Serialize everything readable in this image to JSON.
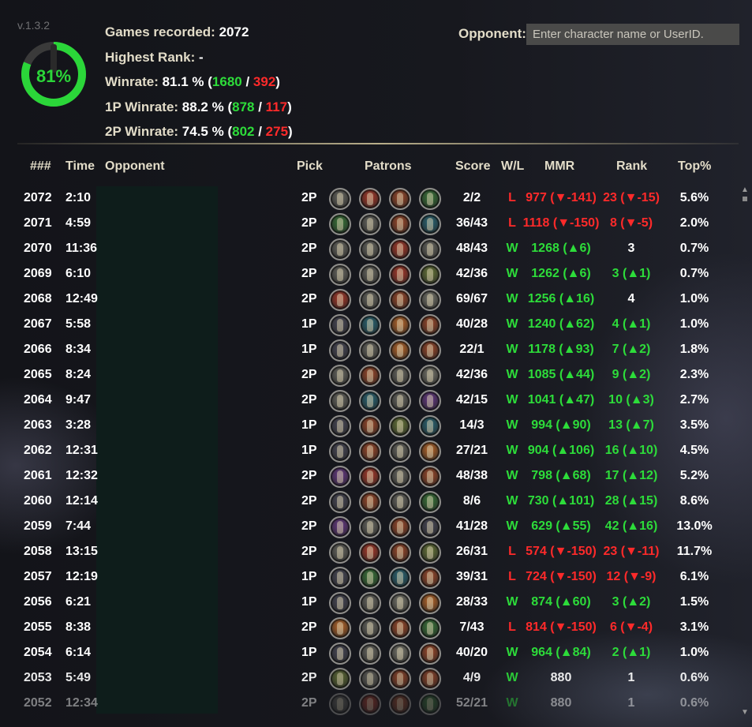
{
  "app": {
    "version": "v.1.3.2",
    "winrate_gauge": {
      "label": "81%",
      "fraction": 0.811,
      "color": "#2bd639"
    }
  },
  "stats": {
    "games_label": "Games recorded:",
    "games_value": "2072",
    "highest_rank_label": "Highest Rank:",
    "highest_rank_value": "-",
    "winrate_label": "Winrate:",
    "winrate_value": "81.1 %",
    "winrate_wins": "1680",
    "winrate_losses": "392",
    "p1_label": "1P Winrate:",
    "p1_value": "88.2 %",
    "p1_wins": "878",
    "p1_losses": "117",
    "p2_label": "2P Winrate:",
    "p2_value": "74.5 %",
    "p2_wins": "802",
    "p2_losses": "275"
  },
  "opponent_search": {
    "label": "Opponent:",
    "placeholder": "Enter character name or UserID.",
    "value": ""
  },
  "colors": {
    "win": "#2ddc3a",
    "loss": "#ff2a2a",
    "accent": "#b8ae8a"
  },
  "table": {
    "headers": {
      "num": "###",
      "time": "Time",
      "opponent": "Opponent",
      "pick": "Pick",
      "patrons": "Patrons",
      "score": "Score",
      "wl": "W/L",
      "mmr": "MMR",
      "rank": "Rank",
      "top": "Top%"
    },
    "rows": [
      {
        "num": "2072",
        "time": "2:10",
        "pick": "2P",
        "patrons": [
          "#6b6b65",
          "#b03a2a",
          "#a24a2a",
          "#3a7a3a"
        ],
        "score": "2/2",
        "wl": "L",
        "mmr": "977",
        "mmr_delta": "▼-141",
        "mmr_dir": "down",
        "rank": "23",
        "rank_delta": "▼-15",
        "rank_dir": "down",
        "top": "5.6%",
        "fade": ""
      },
      {
        "num": "2071",
        "time": "4:59",
        "pick": "2P",
        "patrons": [
          "#3a7a3a",
          "#6b6b65",
          "#a24a2a",
          "#2a6a7a"
        ],
        "score": "36/43",
        "wl": "L",
        "mmr": "1118",
        "mmr_delta": "▼-150",
        "mmr_dir": "down",
        "rank": "8",
        "rank_delta": "▼-5",
        "rank_dir": "down",
        "top": "2.0%",
        "fade": ""
      },
      {
        "num": "2070",
        "time": "11:36",
        "pick": "2P",
        "patrons": [
          "#6b6b65",
          "#6b6b65",
          "#b03a2a",
          "#6b6b65"
        ],
        "score": "48/43",
        "wl": "W",
        "mmr": "1268",
        "mmr_delta": "▲6",
        "mmr_dir": "up",
        "rank": "3",
        "rank_delta": "",
        "rank_dir": "none",
        "top": "0.7%",
        "fade": ""
      },
      {
        "num": "2069",
        "time": "6:10",
        "pick": "2P",
        "patrons": [
          "#6b6b65",
          "#6b6b65",
          "#b03a2a",
          "#6a7a3a"
        ],
        "score": "42/36",
        "wl": "W",
        "mmr": "1262",
        "mmr_delta": "▲6",
        "mmr_dir": "up",
        "rank": "3",
        "rank_delta": "▲1",
        "rank_dir": "up",
        "top": "0.7%",
        "fade": ""
      },
      {
        "num": "2068",
        "time": "12:49",
        "pick": "2P",
        "patrons": [
          "#b03a2a",
          "#6b6b65",
          "#a24a2a",
          "#7a7a70"
        ],
        "score": "69/67",
        "wl": "W",
        "mmr": "1256",
        "mmr_delta": "▲16",
        "mmr_dir": "up",
        "rank": "4",
        "rank_delta": "",
        "rank_dir": "none",
        "top": "1.0%",
        "fade": ""
      },
      {
        "num": "2067",
        "time": "5:58",
        "pick": "1P",
        "patrons": [
          "#4a4a5a",
          "#2a6a7a",
          "#c06a2a",
          "#a24a2a"
        ],
        "score": "40/28",
        "wl": "W",
        "mmr": "1240",
        "mmr_delta": "▲62",
        "mmr_dir": "up",
        "rank": "4",
        "rank_delta": "▲1",
        "rank_dir": "up",
        "top": "1.0%",
        "fade": ""
      },
      {
        "num": "2066",
        "time": "8:34",
        "pick": "1P",
        "patrons": [
          "#4a4a5a",
          "#6b6b65",
          "#c06a2a",
          "#a24a2a"
        ],
        "score": "22/1",
        "wl": "W",
        "mmr": "1178",
        "mmr_delta": "▲93",
        "mmr_dir": "up",
        "rank": "7",
        "rank_delta": "▲2",
        "rank_dir": "up",
        "top": "1.8%",
        "fade": ""
      },
      {
        "num": "2065",
        "time": "8:24",
        "pick": "2P",
        "patrons": [
          "#6b6b65",
          "#a24a2a",
          "#6b6b65",
          "#7a7a70"
        ],
        "score": "42/36",
        "wl": "W",
        "mmr": "1085",
        "mmr_delta": "▲44",
        "mmr_dir": "up",
        "rank": "9",
        "rank_delta": "▲2",
        "rank_dir": "up",
        "top": "2.3%",
        "fade": ""
      },
      {
        "num": "2064",
        "time": "9:47",
        "pick": "2P",
        "patrons": [
          "#6b6b65",
          "#2a6a7a",
          "#6b6b65",
          "#6a3a8a"
        ],
        "score": "42/15",
        "wl": "W",
        "mmr": "1041",
        "mmr_delta": "▲47",
        "mmr_dir": "up",
        "rank": "10",
        "rank_delta": "▲3",
        "rank_dir": "up",
        "top": "2.7%",
        "fade": ""
      },
      {
        "num": "2063",
        "time": "3:28",
        "pick": "1P",
        "patrons": [
          "#4a4a5a",
          "#a24a2a",
          "#6a7a3a",
          "#2a6a7a"
        ],
        "score": "14/3",
        "wl": "W",
        "mmr": "994",
        "mmr_delta": "▲90",
        "mmr_dir": "up",
        "rank": "13",
        "rank_delta": "▲7",
        "rank_dir": "up",
        "top": "3.5%",
        "fade": ""
      },
      {
        "num": "2062",
        "time": "12:31",
        "pick": "1P",
        "patrons": [
          "#4a4a5a",
          "#a24a2a",
          "#6b6b65",
          "#c06a2a"
        ],
        "score": "27/21",
        "wl": "W",
        "mmr": "904",
        "mmr_delta": "▲106",
        "mmr_dir": "up",
        "rank": "16",
        "rank_delta": "▲10",
        "rank_dir": "up",
        "top": "4.5%",
        "fade": ""
      },
      {
        "num": "2061",
        "time": "12:32",
        "pick": "2P",
        "patrons": [
          "#6a3a8a",
          "#b03a2a",
          "#6b6b65",
          "#a24a2a"
        ],
        "score": "48/38",
        "wl": "W",
        "mmr": "798",
        "mmr_delta": "▲68",
        "mmr_dir": "up",
        "rank": "17",
        "rank_delta": "▲12",
        "rank_dir": "up",
        "top": "5.2%",
        "fade": ""
      },
      {
        "num": "2060",
        "time": "12:14",
        "pick": "2P",
        "patrons": [
          "#4a4a5a",
          "#a24a2a",
          "#6b6b65",
          "#3a7a3a"
        ],
        "score": "8/6",
        "wl": "W",
        "mmr": "730",
        "mmr_delta": "▲101",
        "mmr_dir": "up",
        "rank": "28",
        "rank_delta": "▲15",
        "rank_dir": "up",
        "top": "8.6%",
        "fade": ""
      },
      {
        "num": "2059",
        "time": "7:44",
        "pick": "2P",
        "patrons": [
          "#6a3a8a",
          "#6b6b65",
          "#a24a2a",
          "#4a4a5a"
        ],
        "score": "41/28",
        "wl": "W",
        "mmr": "629",
        "mmr_delta": "▲55",
        "mmr_dir": "up",
        "rank": "42",
        "rank_delta": "▲16",
        "rank_dir": "up",
        "top": "13.0%",
        "fade": ""
      },
      {
        "num": "2058",
        "time": "13:15",
        "pick": "2P",
        "patrons": [
          "#6b6b65",
          "#b03a2a",
          "#a24a2a",
          "#6a7a3a"
        ],
        "score": "26/31",
        "wl": "L",
        "mmr": "574",
        "mmr_delta": "▼-150",
        "mmr_dir": "down",
        "rank": "23",
        "rank_delta": "▼-11",
        "rank_dir": "down",
        "top": "11.7%",
        "fade": ""
      },
      {
        "num": "2057",
        "time": "12:19",
        "pick": "1P",
        "patrons": [
          "#4a4a5a",
          "#3a7a3a",
          "#2a6a7a",
          "#a24a2a"
        ],
        "score": "39/31",
        "wl": "L",
        "mmr": "724",
        "mmr_delta": "▼-150",
        "mmr_dir": "down",
        "rank": "12",
        "rank_delta": "▼-9",
        "rank_dir": "down",
        "top": "6.1%",
        "fade": ""
      },
      {
        "num": "2056",
        "time": "6:21",
        "pick": "1P",
        "patrons": [
          "#4a4a5a",
          "#6b6b65",
          "#7a7a70",
          "#c06a2a"
        ],
        "score": "28/33",
        "wl": "W",
        "mmr": "874",
        "mmr_delta": "▲60",
        "mmr_dir": "up",
        "rank": "3",
        "rank_delta": "▲2",
        "rank_dir": "up",
        "top": "1.5%",
        "fade": ""
      },
      {
        "num": "2055",
        "time": "8:38",
        "pick": "2P",
        "patrons": [
          "#c06a2a",
          "#6b6b65",
          "#a24a2a",
          "#3a7a3a"
        ],
        "score": "7/43",
        "wl": "L",
        "mmr": "814",
        "mmr_delta": "▼-150",
        "mmr_dir": "down",
        "rank": "6",
        "rank_delta": "▼-4",
        "rank_dir": "down",
        "top": "3.1%",
        "fade": ""
      },
      {
        "num": "2054",
        "time": "6:14",
        "pick": "1P",
        "patrons": [
          "#4a4a5a",
          "#6b6b65",
          "#7a7a70",
          "#a24a2a"
        ],
        "score": "40/20",
        "wl": "W",
        "mmr": "964",
        "mmr_delta": "▲84",
        "mmr_dir": "up",
        "rank": "2",
        "rank_delta": "▲1",
        "rank_dir": "up",
        "top": "1.0%",
        "fade": ""
      },
      {
        "num": "2053",
        "time": "5:49",
        "pick": "2P",
        "patrons": [
          "#6a7a3a",
          "#6b6b65",
          "#a24a2a",
          "#a24a2a"
        ],
        "score": "4/9",
        "wl": "W",
        "mmr": "880",
        "mmr_delta": "",
        "mmr_dir": "none",
        "rank": "1",
        "rank_delta": "",
        "rank_dir": "none",
        "top": "0.6%",
        "fade": "fade1"
      },
      {
        "num": "2052",
        "time": "12:34",
        "pick": "2P",
        "patrons": [
          "#6b6b65",
          "#b03a2a",
          "#a24a2a",
          "#3a7a3a"
        ],
        "score": "52/21",
        "wl": "W",
        "mmr": "880",
        "mmr_delta": "",
        "mmr_dir": "none",
        "rank": "1",
        "rank_delta": "",
        "rank_dir": "none",
        "top": "0.6%",
        "fade": "fade2"
      }
    ]
  },
  "scrollbar": {
    "up_icon": "▲",
    "down_icon": "▼"
  }
}
